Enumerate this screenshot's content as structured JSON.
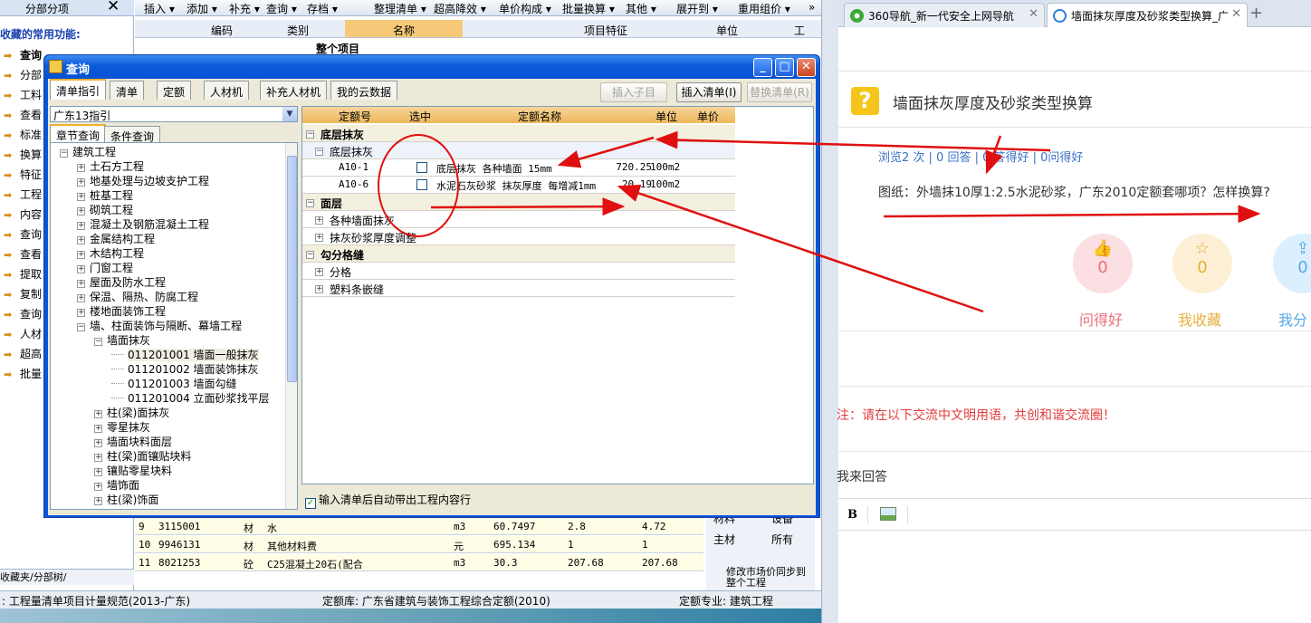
{
  "left_panel": {
    "title": "分部分项",
    "close_glyph": "✕",
    "fav_title": "收藏的常用功能:",
    "items": [
      "查询",
      "分部",
      "工料",
      "查看",
      "标准",
      "换算",
      "特征",
      "工程",
      "内容",
      "查询",
      "查看",
      "提取",
      "复制",
      "查询",
      "人材",
      "超高",
      "批量"
    ],
    "bottom_tabs": "收藏夹/分部树/"
  },
  "toolbar": {
    "items": [
      "插入 ▾",
      "添加 ▾",
      "补充 ▾",
      "查询 ▾",
      "存档 ▾",
      "整理清单 ▾",
      "超高降效 ▾",
      "单价构成 ▾",
      "批量换算 ▾",
      "其他 ▾",
      "展开到 ▾",
      "重用组价 ▾"
    ],
    "more": "»"
  },
  "bg_grid": {
    "headers": [
      "编码",
      "类别",
      "名称",
      "项目特征",
      "单位",
      "工"
    ],
    "top_row": "整个项目",
    "rows": [
      {
        "no": "9",
        "code": "3115001",
        "type": "材",
        "name": "水",
        "unit": "m3",
        "qty": "60.7497",
        "p1": "2.8",
        "p2": "4.72"
      },
      {
        "no": "10",
        "code": "9946131",
        "type": "材",
        "name": "其他材料费",
        "unit": "元",
        "qty": "695.134",
        "p1": "1",
        "p2": "1"
      },
      {
        "no": "11",
        "code": "8021253",
        "type": "砼",
        "name": "C25混凝土20石(配合",
        "unit": "m3",
        "qty": "30.3",
        "p1": "207.68",
        "p2": "207.68"
      }
    ],
    "right_ctrl": {
      "r1a": "材料",
      "r1b": "设备",
      "r2a": "主材",
      "r2b": "所有",
      "sync": "修改市场价同步到整个工程"
    }
  },
  "status_bar": {
    "left": ": 工程量清单项目计量规范(2013-广东)",
    "mid": "定额库: 广东省建筑与装饰工程综合定额(2010)",
    "right": "定额专业: 建筑工程"
  },
  "dialog": {
    "title": "查询",
    "tabs": [
      "清单指引",
      "清单",
      "定额",
      "人材机",
      "补充人材机",
      "我的云数据"
    ],
    "buttons": {
      "insert_child": "插入子目",
      "insert_list": "插入清单(I)",
      "replace_list": "替换清单(R)"
    },
    "library": "广东13指引",
    "tree_tabs": [
      "章节查询",
      "条件查询"
    ],
    "tree": [
      {
        "t": "建筑工程",
        "pm": "−"
      },
      {
        "t": "土石方工程",
        "pm": "+"
      },
      {
        "t": "地基处理与边坡支护工程",
        "pm": "+"
      },
      {
        "t": "桩基工程",
        "pm": "+"
      },
      {
        "t": "砌筑工程",
        "pm": "+"
      },
      {
        "t": "混凝土及钢筋混凝土工程",
        "pm": "+"
      },
      {
        "t": "金属结构工程",
        "pm": "+"
      },
      {
        "t": "木结构工程",
        "pm": "+"
      },
      {
        "t": "门窗工程",
        "pm": "+"
      },
      {
        "t": "屋面及防水工程",
        "pm": "+"
      },
      {
        "t": "保温、隔热、防腐工程",
        "pm": "+"
      },
      {
        "t": "楼地面装饰工程",
        "pm": "+"
      },
      {
        "t": "墙、柱面装饰与隔断、幕墙工程",
        "pm": "−"
      },
      {
        "t": "墙面抹灰",
        "pm": "−"
      },
      {
        "t": "011201001   墙面一般抹灰",
        "pm": ""
      },
      {
        "t": "011201002   墙面装饰抹灰",
        "pm": ""
      },
      {
        "t": "011201003   墙面勾缝",
        "pm": ""
      },
      {
        "t": "011201004   立面砂浆找平层",
        "pm": ""
      },
      {
        "t": "柱(梁)面抹灰",
        "pm": "+"
      },
      {
        "t": "零星抹灰",
        "pm": "+"
      },
      {
        "t": "墙面块料面层",
        "pm": "+"
      },
      {
        "t": "柱(梁)面镶贴块料",
        "pm": "+"
      },
      {
        "t": "镶贴零星块料",
        "pm": "+"
      },
      {
        "t": "墙饰面",
        "pm": "+"
      },
      {
        "t": "柱(梁)饰面",
        "pm": "+"
      }
    ],
    "table": {
      "headers": [
        "定额号",
        "选中",
        "定额名称",
        "单位",
        "单价"
      ],
      "groups": [
        {
          "label": "底层抹灰",
          "sub": "底层抹灰",
          "rows": [
            {
              "code": "A10-1",
              "name": "底层抹灰 各种墙面 15mm",
              "unit": "100m2",
              "price": "720.25"
            },
            {
              "code": "A10-6",
              "name": "水泥石灰砂浆 抹灰厚度 每增减1mm",
              "unit": "100m2",
              "price": "20.19"
            }
          ]
        },
        {
          "label": "面层",
          "subs": [
            "各种墙面抹灰",
            "抹灰砂浆厚度调整"
          ]
        },
        {
          "label": "勾分格缝",
          "subs": [
            "分格",
            "塑料条嵌缝"
          ]
        }
      ]
    },
    "auto_option": "输入清单后自动带出工程内容行"
  },
  "browser": {
    "tabs": [
      {
        "label": "360导航_新一代安全上网导航"
      },
      {
        "label": "墙面抹灰厚度及砂浆类型换算_广"
      }
    ],
    "new_tab": "+",
    "question_title": "墙面抹灰厚度及砂浆类型换算",
    "stats": "浏览2 次 | 0 回答 | 0 答得好 | 0问得好",
    "body": "图纸：外墙抹10厚1:2.5水泥砂浆，广东2010定额套哪项？怎样换算?",
    "actions": [
      {
        "label": "问得好",
        "count": "0",
        "color": "#e8707a",
        "bg": "#fbdfe2"
      },
      {
        "label": "我收藏",
        "count": "0",
        "color": "#e7ae3c",
        "bg": "#fcefd5"
      },
      {
        "label": "我分",
        "count": "0",
        "color": "#55a9e6",
        "bg": "#dcefff"
      }
    ],
    "notice": "注：请在以下交流中文明用语，共创和谐交流圈！",
    "answer_title": "我来回答",
    "editor_bold": "B"
  }
}
